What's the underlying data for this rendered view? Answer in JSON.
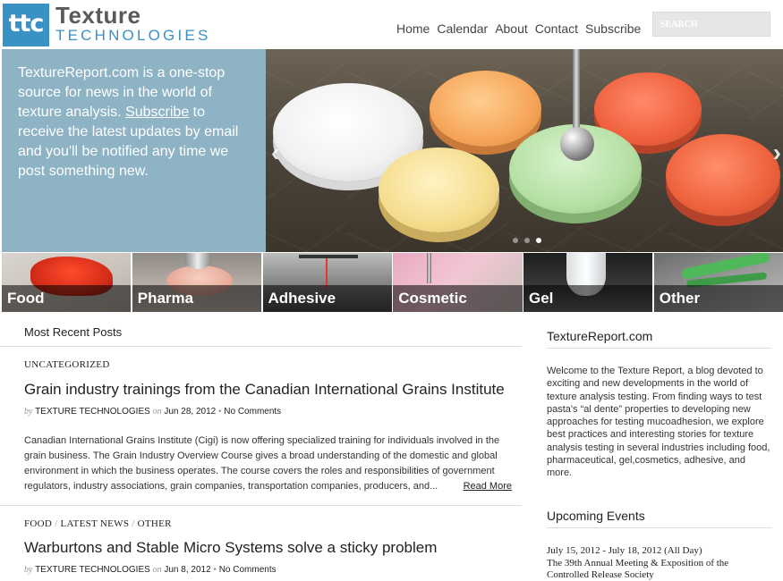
{
  "brand": {
    "mark": "ttc",
    "word1": "Texture",
    "word2": "TECHNOLOGIES"
  },
  "nav": {
    "items": [
      "Home",
      "Calendar",
      "About",
      "Contact",
      "Subscribe"
    ]
  },
  "search": {
    "placeholder": "SEARCH"
  },
  "hero": {
    "text_before": "TextureReport.com is a one-stop source for news in the world of texture analysis.",
    "link": "Subscribe",
    "text_after": "to receive the latest updates by email and you'll be notified any time we post something new."
  },
  "slider": {
    "prev": "‹",
    "next": "›",
    "dots": 3,
    "active_dot": 3
  },
  "categories": [
    "Food",
    "Pharma",
    "Adhesive",
    "Cosmetic",
    "Gel",
    "Other"
  ],
  "main": {
    "section_title": "Most Recent Posts",
    "posts": [
      {
        "categories": [
          "UNCATEGORIZED"
        ],
        "title": "Grain industry trainings from the Canadian International Grains Institute",
        "by": "by",
        "author": "TEXTURE TECHNOLOGIES",
        "on": "on",
        "date": "Jun 28, 2012",
        "comments": "No Comments",
        "excerpt": "Canadian International Grains Institute (Cigi) is now offering specialized training for individuals involved in the grain business. The Grain Industry Overview Course gives a broad understanding of the domestic and global environment in which the business operates. The course covers the roles and responsibilities of government regulators, industry associations, grain companies, transportation companies, producers, and...",
        "read_more": "Read More"
      },
      {
        "categories": [
          "FOOD",
          "LATEST NEWS",
          "OTHER"
        ],
        "title": "Warburtons and Stable Micro Systems solve a sticky problem",
        "by": "by",
        "author": "TEXTURE TECHNOLOGIES",
        "on": "on",
        "date": "Jun 8, 2012",
        "comments": "No Comments"
      }
    ]
  },
  "sidebar": {
    "about_title": "TextureReport.com",
    "about_text": "Welcome to the Texture Report, a blog devoted to exciting and new developments in the world of texture analysis testing. From finding ways to test pasta's “al dente” properties to developing new approaches for testing mucoadhesion, we explore best practices and interesting stories for texture analysis testing in several industries including food, pharmaceutical, gel,cosmetics, adhesive, and more.",
    "events_title": "Upcoming Events",
    "events": [
      {
        "date": "July 15, 2012 - July 18, 2012 (All Day)",
        "title": "The 39th Annual Meeting & Exposition of the Controlled Release Society"
      }
    ]
  },
  "colors": {
    "accent_blue": "#3a91c4",
    "hero_panel": "#8db3c5",
    "divider": "#dddddd"
  }
}
